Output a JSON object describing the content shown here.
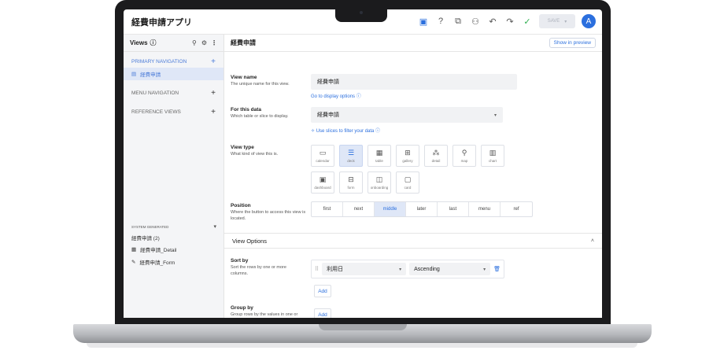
{
  "header": {
    "app_title": "経費申請アプリ",
    "save_label": "SAVE",
    "avatar_initial": "A"
  },
  "sidebar": {
    "views_label": "Views",
    "primary_nav": "PRIMARY NAVIGATION",
    "primary_item": "経費申請",
    "menu_nav": "MENU NAVIGATION",
    "reference_views": "REFERENCE VIEWS",
    "system_generated": "SYSTEM GENERATED",
    "sys_group": "経費申請 (2)",
    "sys_items": [
      "経費申請_Detail",
      "経費申請_Form"
    ]
  },
  "main": {
    "title": "経費申請",
    "preview_label": "Show in preview",
    "view_name": {
      "title": "View name",
      "sub": "The unique name for this view.",
      "value": "経費申請",
      "link": "Go to display options ⓘ"
    },
    "for_data": {
      "title": "For this data",
      "sub": "Which table or slice to display.",
      "value": "経費申請",
      "link": "✧ Use slices to filter your data  ⓘ"
    },
    "view_type": {
      "title": "View type",
      "sub": "What kind of view this is.",
      "types": [
        "calendar",
        "deck",
        "table",
        "gallery",
        "detail",
        "map",
        "chart",
        "dashboard",
        "form",
        "onboarding",
        "card"
      ],
      "selected": "deck"
    },
    "position": {
      "title": "Position",
      "sub": "Where the button to access this view is located.",
      "options": [
        "first",
        "next",
        "middle",
        "later",
        "last",
        "menu",
        "ref"
      ],
      "selected": "middle"
    },
    "view_options_label": "View Options",
    "sort_by": {
      "title": "Sort by",
      "sub": "Sort the rows by one or more columns.",
      "column": "利用日",
      "order": "Ascending",
      "add_label": "Add"
    },
    "group_by": {
      "title": "Group by",
      "sub": "Group rows by the values in one or",
      "add_label": "Add"
    }
  }
}
